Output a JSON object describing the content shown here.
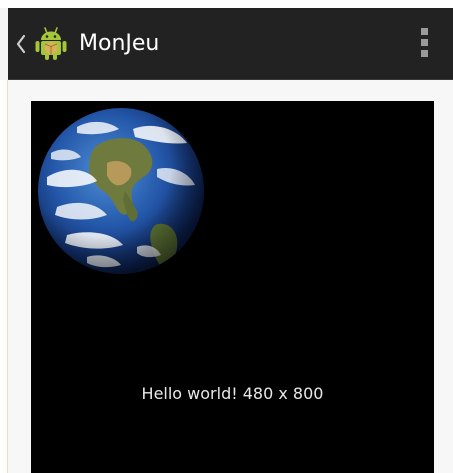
{
  "action_bar": {
    "title": "MonJeu",
    "up_icon": "chevron-left-icon",
    "app_icon": "android-robot-icon",
    "overflow_icon": "overflow-menu-icon",
    "background": "#222222",
    "title_color": "#ffffff"
  },
  "game": {
    "background": "#000000",
    "sprite": "earth-globe-icon",
    "message": "Hello world! 480 x 800"
  }
}
